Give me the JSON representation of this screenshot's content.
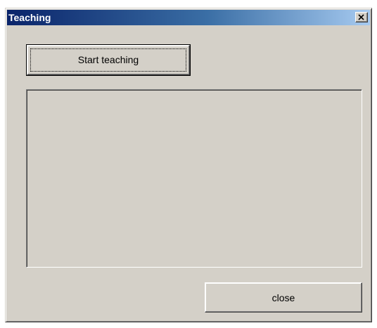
{
  "window": {
    "title": "Teaching",
    "close_icon": "close-x-icon"
  },
  "main": {
    "start_button_label": "Start teaching",
    "close_button_label": "close"
  },
  "colors": {
    "face": "#d4d0c8",
    "title_start": "#0a246a",
    "title_end": "#a6caf0",
    "title_text": "#ffffff"
  }
}
